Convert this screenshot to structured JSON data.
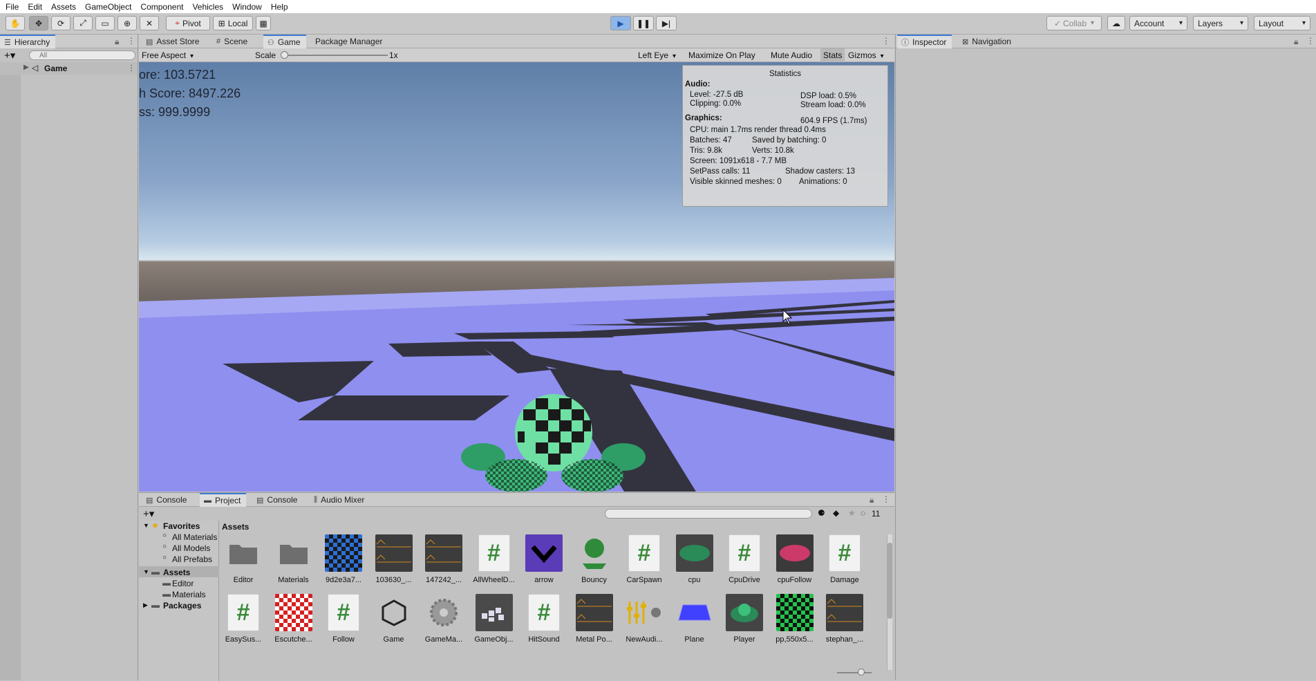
{
  "menu": [
    "File",
    "Edit",
    "Assets",
    "GameObject",
    "Component",
    "Vehicles",
    "Window",
    "Help"
  ],
  "toolbar": {
    "pivot": "Pivot",
    "local": "Local",
    "collab": "Collab",
    "account": "Account",
    "layers": "Layers",
    "layout": "Layout"
  },
  "hierarchy": {
    "tab": "Hierarchy",
    "search_placeholder": "All",
    "scene": "Game"
  },
  "game_tabs": [
    "Asset Store",
    "Scene",
    "Game",
    "Package Manager"
  ],
  "game_toolbar": {
    "aspect": "Free Aspect",
    "scale_label": "Scale",
    "scale_value": "1x",
    "eye": "Left Eye",
    "maximize": "Maximize On Play",
    "mute": "Mute Audio",
    "stats": "Stats",
    "gizmos": "Gizmos"
  },
  "hud": {
    "score": "ore: 103.5721",
    "high": "h Score: 8497.226",
    "third": "ss: 999.9999"
  },
  "stats": {
    "title": "Statistics",
    "audio": "Audio:",
    "level": "Level: -27.5 dB",
    "dsp": "DSP load: 0.5%",
    "clipping": "Clipping: 0.0%",
    "stream": "Stream load: 0.0%",
    "graphics": "Graphics:",
    "fps": "604.9 FPS (1.7ms)",
    "cpu": "CPU: main 1.7ms  render thread 0.4ms",
    "batches": "Batches: 47",
    "saved": "Saved by batching: 0",
    "tris": "Tris: 9.8k",
    "verts": "Verts: 10.8k",
    "screen": "Screen: 1091x618 - 7.7 MB",
    "setpass": "SetPass calls: 11",
    "shadow": "Shadow casters: 13",
    "skinned": "Visible skinned meshes: 0",
    "animations": "Animations: 0"
  },
  "inspector_tabs": [
    "Inspector",
    "Navigation"
  ],
  "bottom_tabs": [
    "Console",
    "Project",
    "Console",
    "Audio Mixer"
  ],
  "project": {
    "hidden_count": "11",
    "favorites": "Favorites",
    "fav_items": [
      "All Materials",
      "All Models",
      "All Prefabs"
    ],
    "assets": "Assets",
    "asset_folders": [
      "Editor",
      "Materials"
    ],
    "packages": "Packages",
    "breadcrumb": "Assets",
    "row1": [
      "Editor",
      "Materials",
      "9d2e3a7...",
      "103630_...",
      "147242_...",
      "AllWheelD...",
      "arrow",
      "Bouncy",
      "CarSpawn",
      "cpu",
      "CpuDrive",
      "cpuFollow",
      "Damage"
    ],
    "row2": [
      "EasySus...",
      "Escutche...",
      "Follow",
      "Game",
      "GameMa...",
      "GameObj...",
      "HitSound",
      "Metal Po...",
      "NewAudi...",
      "Plane",
      "Player",
      "pp,550x5...",
      "stephan_..."
    ]
  }
}
